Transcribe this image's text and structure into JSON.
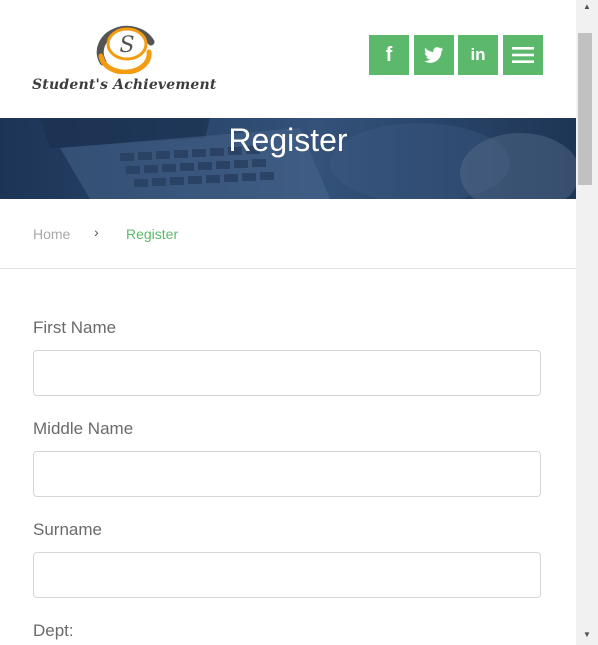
{
  "brand": {
    "logo_letter": "S",
    "logo_text": "Student's Achievement",
    "colors": {
      "accent_green": "#5cb96b",
      "logo_orange": "#f39c12",
      "logo_gray": "#555555",
      "banner_navy": "#2b476d"
    }
  },
  "header": {
    "social": [
      {
        "icon": "facebook-icon",
        "glyph": "f"
      },
      {
        "icon": "twitter-icon",
        "glyph": "t"
      },
      {
        "icon": "linkedin-icon",
        "glyph": "in"
      },
      {
        "icon": "hamburger-menu-icon",
        "glyph": "≡"
      }
    ]
  },
  "banner": {
    "title": "Register"
  },
  "breadcrumb": {
    "home": "Home",
    "separator": "›",
    "current": "Register"
  },
  "form": {
    "first_name": {
      "label": "First Name",
      "value": ""
    },
    "middle_name": {
      "label": "Middle Name",
      "value": ""
    },
    "surname": {
      "label": "Surname",
      "value": ""
    },
    "dept": {
      "label": "Dept:"
    }
  },
  "scrollbar": {
    "up": "▲",
    "down": "▼"
  }
}
